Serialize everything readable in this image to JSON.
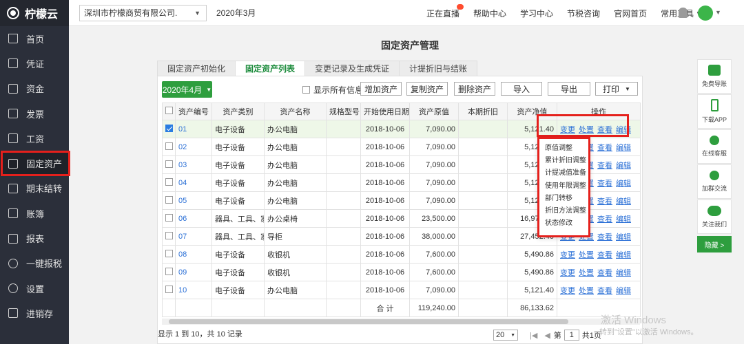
{
  "sidebar": {
    "brand": "柠檬云",
    "items": [
      {
        "label": "首页",
        "icon": "home-icon"
      },
      {
        "label": "凭证",
        "icon": "voucher-icon"
      },
      {
        "label": "资金",
        "icon": "fund-icon"
      },
      {
        "label": "发票",
        "icon": "invoice-icon"
      },
      {
        "label": "工资",
        "icon": "salary-icon"
      },
      {
        "label": "固定资产",
        "icon": "fixed-asset-icon",
        "active": true
      },
      {
        "label": "期末结转",
        "icon": "period-end-icon"
      },
      {
        "label": "账簿",
        "icon": "ledger-icon"
      },
      {
        "label": "报表",
        "icon": "report-icon"
      },
      {
        "label": "一键报税",
        "icon": "tax-icon"
      },
      {
        "label": "设置",
        "icon": "settings-icon"
      },
      {
        "label": "进销存",
        "icon": "inventory-icon"
      }
    ]
  },
  "topbar": {
    "company": "深圳市柠檬商贸有限公司.",
    "period": "2020年3月",
    "links": [
      "正在直播",
      "帮助中心",
      "学习中心",
      "节税咨询",
      "官网首页",
      "常用工具 ∨"
    ]
  },
  "page": {
    "title": "固定资产管理",
    "tabs": [
      "固定资产初始化",
      "固定资产列表",
      "变更记录及生成凭证",
      "计提折旧与结账"
    ]
  },
  "toolbar": {
    "month": "2020年4月",
    "show_all": "显示所有信息",
    "add": "增加资产",
    "copy": "复制资产",
    "delete": "删除资产",
    "import": "导入",
    "export": "导出",
    "print": "打印"
  },
  "table": {
    "headers": [
      "资产编号",
      "资产类别",
      "资产名称",
      "规格型号",
      "开始使用日期",
      "资产原值",
      "本期折旧",
      "资产净值",
      "操作"
    ],
    "rows": [
      {
        "code": "01",
        "category": "电子设备",
        "name": "办公电脑",
        "date": "2018-10-06",
        "original": "7,090.00",
        "net": "5,121.40",
        "checked": true
      },
      {
        "code": "02",
        "category": "电子设备",
        "name": "办公电脑",
        "date": "2018-10-06",
        "original": "7,090.00",
        "net": "5,121.40"
      },
      {
        "code": "03",
        "category": "电子设备",
        "name": "办公电脑",
        "date": "2018-10-06",
        "original": "7,090.00",
        "net": "5,121.40"
      },
      {
        "code": "04",
        "category": "电子设备",
        "name": "办公电脑",
        "date": "2018-10-06",
        "original": "7,090.00",
        "net": "5,121.40"
      },
      {
        "code": "05",
        "category": "电子设备",
        "name": "办公电脑",
        "date": "2018-10-06",
        "original": "7,090.00",
        "net": "5,121.40"
      },
      {
        "code": "06",
        "category": "器具、工具、家具",
        "name": "办公桌椅",
        "date": "2018-10-06",
        "original": "23,500.00",
        "net": "16,976.40"
      },
      {
        "code": "07",
        "category": "器具、工具、家具",
        "name": "导柜",
        "date": "2018-10-06",
        "original": "38,000.00",
        "net": "27,452.40"
      },
      {
        "code": "08",
        "category": "电子设备",
        "name": "收银机",
        "date": "2018-10-06",
        "original": "7,600.00",
        "net": "5,490.86"
      },
      {
        "code": "09",
        "category": "电子设备",
        "name": "收银机",
        "date": "2018-10-06",
        "original": "7,600.00",
        "net": "5,490.86"
      },
      {
        "code": "10",
        "category": "电子设备",
        "name": "办公电脑",
        "date": "2018-10-06",
        "original": "7,090.00",
        "net": "5,121.40"
      }
    ],
    "actions": [
      "变更",
      "处置",
      "查看",
      "编辑"
    ],
    "total_label": "合 计",
    "total_original": "119,240.00",
    "total_net": "86,133.62"
  },
  "dropdown": [
    "原值调整",
    "累计折旧调整",
    "计提减值准备",
    "使用年限调整",
    "部门转移",
    "折旧方法调整",
    "状态修改"
  ],
  "footer": {
    "summary": "显示 1 到 10，共 10 记录",
    "page_size": "20",
    "page_prefix": "第",
    "page": "1",
    "page_suffix": "共1页"
  },
  "rightbar": [
    "免费导账",
    "下载APP",
    "在线客服",
    "加群交流",
    "关注我们"
  ],
  "hide_label": "隐藏 >",
  "watermark": {
    "line1": "激活 Windows",
    "line2": "转到\"设置\"以激活 Windows。"
  }
}
